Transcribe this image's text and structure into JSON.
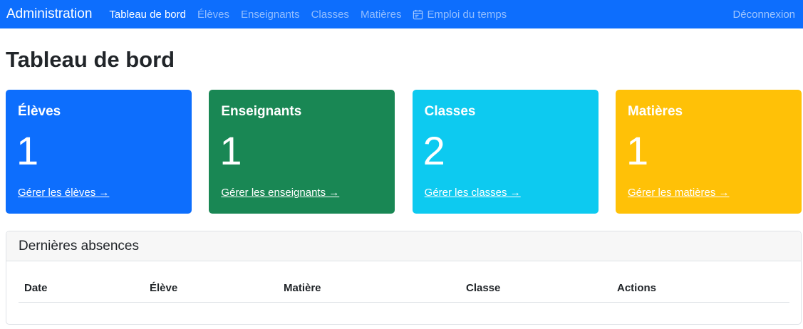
{
  "navbar": {
    "brand": "Administration",
    "links": [
      {
        "label": "Tableau de bord",
        "active": true
      },
      {
        "label": "Élèves",
        "active": false
      },
      {
        "label": "Enseignants",
        "active": false
      },
      {
        "label": "Classes",
        "active": false
      },
      {
        "label": "Matières",
        "active": false
      },
      {
        "label": "Emploi du temps",
        "active": false,
        "icon": "calendar-icon"
      }
    ],
    "logout": "Déconnexion"
  },
  "page": {
    "title": "Tableau de bord"
  },
  "cards": [
    {
      "title": "Élèves",
      "count": "1",
      "link": "Gérer les élèves →",
      "color": "#0d6efd"
    },
    {
      "title": "Enseignants",
      "count": "1",
      "link": "Gérer les enseignants →",
      "color": "#198754"
    },
    {
      "title": "Classes",
      "count": "2",
      "link": "Gérer les classes →",
      "color": "#0dcaf0"
    },
    {
      "title": "Matières",
      "count": "1",
      "link": "Gérer les matières →",
      "color": "#ffc107"
    }
  ],
  "absences": {
    "title": "Dernières absences",
    "columns": [
      "Date",
      "Élève",
      "Matière",
      "Classe",
      "Actions"
    ]
  }
}
